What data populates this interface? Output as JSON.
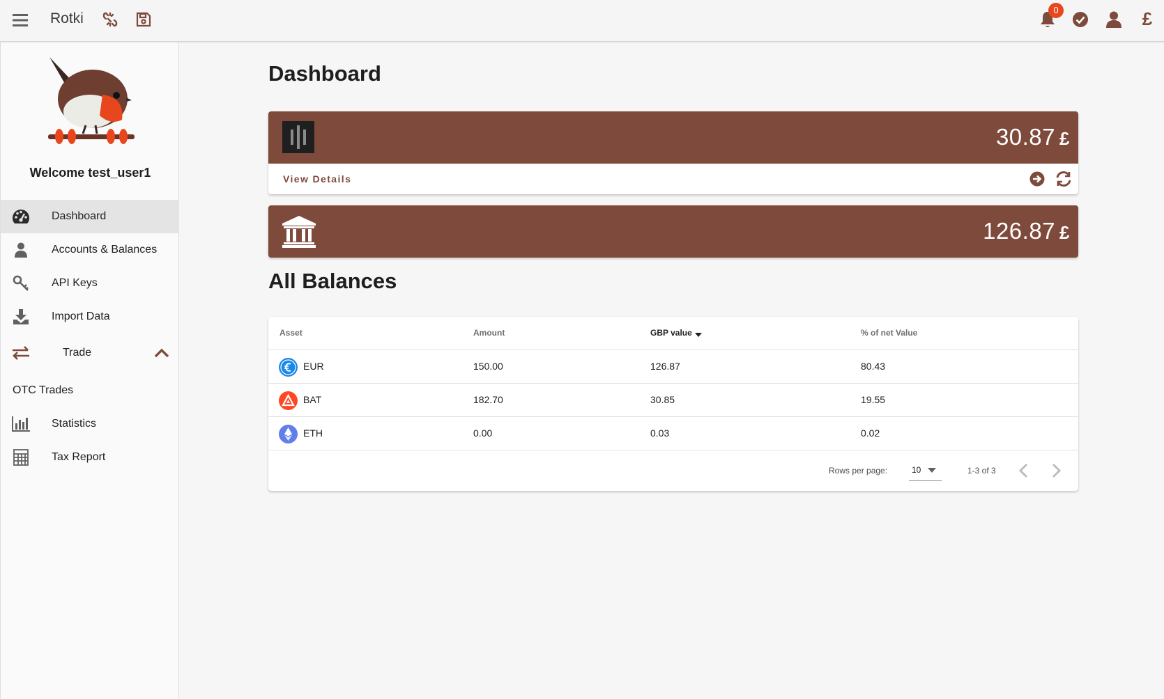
{
  "app": {
    "title": "Rotki",
    "notification_count": "0",
    "currency_symbol": "£"
  },
  "colors": {
    "brand": "#7e4a3b",
    "badge": "#e8471d",
    "eur": "#1a88e8",
    "bat": "#ff4724",
    "eth": "#627eea"
  },
  "sidebar": {
    "welcome": "Welcome test_user1",
    "items": [
      {
        "label": "Dashboard",
        "icon": "dashboard-gauge-icon",
        "active": true
      },
      {
        "label": "Accounts & Balances",
        "icon": "user-icon"
      },
      {
        "label": "API Keys",
        "icon": "key-icon"
      },
      {
        "label": "Import Data",
        "icon": "download-icon"
      },
      {
        "label": "Trade",
        "icon": "exchange-icon",
        "expanded": true
      },
      {
        "label": "OTC Trades"
      },
      {
        "label": "Statistics",
        "icon": "bar-chart-icon"
      },
      {
        "label": "Tax Report",
        "icon": "calculator-icon"
      }
    ]
  },
  "main": {
    "title": "Dashboard",
    "cards": [
      {
        "value": "30.87",
        "currency": "£",
        "icon": "exchange-logo-icon",
        "footer_link": "View Details"
      },
      {
        "value": "126.87",
        "currency": "£",
        "icon": "bank-icon"
      }
    ],
    "balances": {
      "title": "All Balances",
      "headers": [
        "Asset",
        "Amount",
        "GBP value",
        "% of net Value"
      ],
      "sorted_column": "GBP value",
      "rows": [
        {
          "asset": "EUR",
          "amount": "150.00",
          "value": "126.87",
          "percent": "80.43"
        },
        {
          "asset": "BAT",
          "amount": "182.70",
          "value": "30.85",
          "percent": "19.55"
        },
        {
          "asset": "ETH",
          "amount": "0.00",
          "value": "0.03",
          "percent": "0.02"
        }
      ],
      "rows_per_page_label": "Rows per page:",
      "rows_per_page": "10",
      "page_info": "1-3 of 3"
    }
  }
}
